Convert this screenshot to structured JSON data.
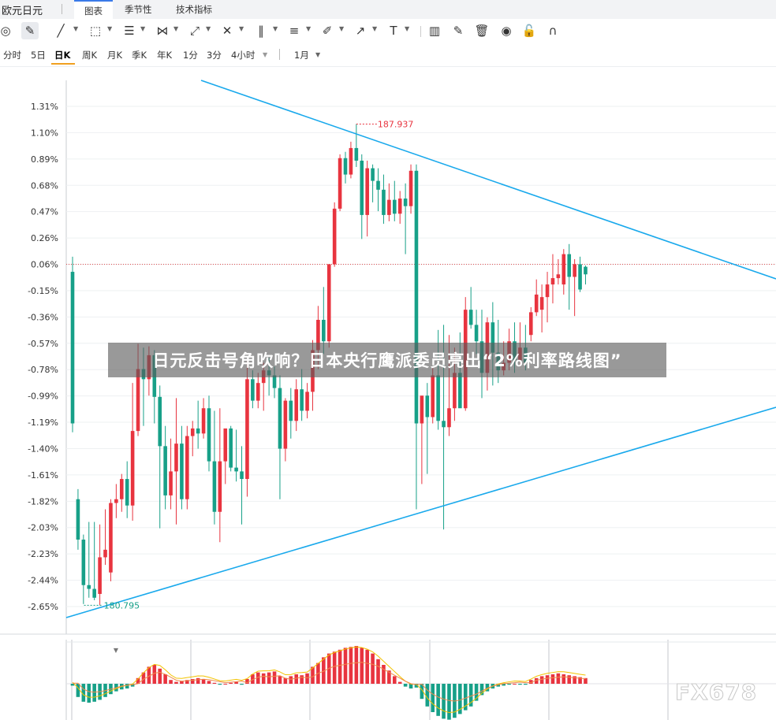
{
  "header": {
    "instrument": "欧元日元",
    "tabs": [
      {
        "label": "图表",
        "active": true
      },
      {
        "label": "季节性",
        "active": false
      },
      {
        "label": "技术指标",
        "active": false
      }
    ]
  },
  "toolbar": {
    "tools": [
      "crosshair-icon",
      "pencil-icon",
      "line-icon",
      "rect-icon",
      "hline-icon",
      "pattern-icon",
      "fib-icon",
      "measure-icon",
      "vlines-icon",
      "parallel-icon",
      "brush-icon",
      "arrow-icon",
      "text-icon",
      "indicator-icon",
      "edit-icon",
      "trash-icon",
      "eye-icon",
      "lock-icon",
      "magnet-icon"
    ]
  },
  "periods": {
    "items": [
      "分时",
      "5日",
      "日K",
      "周K",
      "月K",
      "季K",
      "年K",
      "1分",
      "3分",
      "4小时"
    ],
    "active": "日K",
    "range_label": "1月"
  },
  "banner": {
    "text": "日元反击号角吹响？日本央行鹰派委员亮出“2%利率路线图”"
  },
  "watermark": "FX678",
  "chart_data": {
    "type": "candlestick",
    "y_tick_labels": [
      "1.31%",
      "1.10%",
      "0.89%",
      "0.68%",
      "0.47%",
      "0.26%",
      "0.06%",
      "-0.15%",
      "-0.36%",
      "-0.57%",
      "-0.78%",
      "-0.99%",
      "-1.19%",
      "-1.40%",
      "-1.61%",
      "-1.82%",
      "-2.03%",
      "-2.23%",
      "-2.44%",
      "-2.65%"
    ],
    "ylim_pct": [
      -2.65,
      1.31
    ],
    "reference_pct": 0.06,
    "annotations": {
      "high_label": "187.937",
      "low_label": "180.795"
    },
    "colors": {
      "up": "#e8343f",
      "down": "#17a088",
      "trendline": "#19a9ec",
      "reference": "#e05050"
    },
    "candles": [
      {
        "o": 0.0,
        "h": 0.12,
        "l": -1.27,
        "c": -1.2
      },
      {
        "o": -1.8,
        "h": -1.72,
        "l": -2.2,
        "c": -2.12
      },
      {
        "o": -2.12,
        "h": -2.08,
        "l": -2.63,
        "c": -2.48
      },
      {
        "o": -2.48,
        "h": -1.98,
        "l": -2.58,
        "c": -2.51
      },
      {
        "o": -2.51,
        "h": -1.98,
        "l": -2.6,
        "c": -2.58
      },
      {
        "o": -2.55,
        "h": -2.0,
        "l": -2.64,
        "c": -2.26
      },
      {
        "o": -2.26,
        "h": -1.88,
        "l": -2.32,
        "c": -2.2
      },
      {
        "o": -2.38,
        "h": -1.8,
        "l": -2.45,
        "c": -1.83
      },
      {
        "o": -1.83,
        "h": -1.68,
        "l": -1.95,
        "c": -1.8
      },
      {
        "o": -1.8,
        "h": -1.6,
        "l": -1.9,
        "c": -1.64
      },
      {
        "o": -1.64,
        "h": -1.5,
        "l": -1.95,
        "c": -1.85
      },
      {
        "o": -1.85,
        "h": -0.88,
        "l": -1.97,
        "c": -1.26
      },
      {
        "o": -1.26,
        "h": -0.57,
        "l": -1.3,
        "c": -0.77
      },
      {
        "o": -0.77,
        "h": -0.6,
        "l": -1.22,
        "c": -0.85
      },
      {
        "o": -0.85,
        "h": -0.59,
        "l": -0.98,
        "c": -0.66
      },
      {
        "o": -0.66,
        "h": -0.62,
        "l": -1.2,
        "c": -0.99
      },
      {
        "o": -0.99,
        "h": -0.9,
        "l": -2.03,
        "c": -1.38
      },
      {
        "o": -1.38,
        "h": -1.22,
        "l": -1.88,
        "c": -1.77
      },
      {
        "o": -1.77,
        "h": -1.32,
        "l": -1.88,
        "c": -1.58
      },
      {
        "o": -1.58,
        "h": -1.0,
        "l": -2.0,
        "c": -1.36
      },
      {
        "o": -1.36,
        "h": -1.22,
        "l": -1.88,
        "c": -1.8
      },
      {
        "o": -1.8,
        "h": -1.22,
        "l": -1.88,
        "c": -1.3
      },
      {
        "o": -1.3,
        "h": -1.18,
        "l": -1.46,
        "c": -1.24
      },
      {
        "o": -1.24,
        "h": -1.02,
        "l": -1.4,
        "c": -1.28
      },
      {
        "o": -1.28,
        "h": -1.0,
        "l": -1.32,
        "c": -1.08
      },
      {
        "o": -1.08,
        "h": -0.98,
        "l": -1.58,
        "c": -1.5
      },
      {
        "o": -1.5,
        "h": -1.1,
        "l": -2.0,
        "c": -1.9
      },
      {
        "o": -1.9,
        "h": -1.08,
        "l": -2.14,
        "c": -1.5
      },
      {
        "o": -1.5,
        "h": -1.28,
        "l": -1.68,
        "c": -1.24
      },
      {
        "o": -1.24,
        "h": -1.22,
        "l": -1.58,
        "c": -1.55
      },
      {
        "o": -1.55,
        "h": -1.25,
        "l": -1.66,
        "c": -1.58
      },
      {
        "o": -1.58,
        "h": -1.38,
        "l": -2.0,
        "c": -1.64
      },
      {
        "o": -1.64,
        "h": -0.7,
        "l": -1.78,
        "c": -0.85
      },
      {
        "o": -0.85,
        "h": -0.78,
        "l": -1.08,
        "c": -1.02
      },
      {
        "o": -1.02,
        "h": -0.8,
        "l": -1.08,
        "c": -0.88
      },
      {
        "o": -0.88,
        "h": -0.72,
        "l": -1.1,
        "c": -0.78
      },
      {
        "o": -0.78,
        "h": -0.68,
        "l": -0.98,
        "c": -0.82
      },
      {
        "o": -0.82,
        "h": -0.75,
        "l": -1.0,
        "c": -0.92
      },
      {
        "o": -0.92,
        "h": -0.82,
        "l": -1.8,
        "c": -1.4
      },
      {
        "o": -1.4,
        "h": -1.0,
        "l": -1.5,
        "c": -1.02
      },
      {
        "o": -1.02,
        "h": -0.92,
        "l": -1.32,
        "c": -1.18
      },
      {
        "o": -1.18,
        "h": -0.85,
        "l": -1.26,
        "c": -0.93
      },
      {
        "o": -0.93,
        "h": -0.77,
        "l": -1.18,
        "c": -1.1
      },
      {
        "o": -1.1,
        "h": -0.88,
        "l": -1.16,
        "c": -0.95
      },
      {
        "o": -0.95,
        "h": -0.54,
        "l": -1.1,
        "c": -0.62
      },
      {
        "o": -0.62,
        "h": -0.27,
        "l": -0.77,
        "c": -0.38
      },
      {
        "o": -0.38,
        "h": -0.12,
        "l": -0.65,
        "c": -0.55
      },
      {
        "o": -0.55,
        "h": 0.04,
        "l": -0.6,
        "c": 0.06
      },
      {
        "o": 0.06,
        "h": 0.55,
        "l": 0.04,
        "c": 0.5
      },
      {
        "o": 0.5,
        "h": 0.93,
        "l": 0.48,
        "c": 0.9
      },
      {
        "o": 0.9,
        "h": 0.95,
        "l": 0.7,
        "c": 0.77
      },
      {
        "o": 0.77,
        "h": 1.03,
        "l": 0.74,
        "c": 0.98
      },
      {
        "o": 0.98,
        "h": 1.17,
        "l": 0.83,
        "c": 0.88
      },
      {
        "o": 0.88,
        "h": 0.93,
        "l": 0.26,
        "c": 0.45
      },
      {
        "o": 0.45,
        "h": 0.88,
        "l": 0.28,
        "c": 0.82
      },
      {
        "o": 0.82,
        "h": 0.85,
        "l": 0.55,
        "c": 0.72
      },
      {
        "o": 0.72,
        "h": 0.82,
        "l": 0.48,
        "c": 0.65
      },
      {
        "o": 0.65,
        "h": 0.77,
        "l": 0.38,
        "c": 0.45
      },
      {
        "o": 0.45,
        "h": 0.7,
        "l": 0.4,
        "c": 0.57
      },
      {
        "o": 0.57,
        "h": 0.72,
        "l": 0.4,
        "c": 0.46
      },
      {
        "o": 0.46,
        "h": 0.64,
        "l": 0.38,
        "c": 0.58
      },
      {
        "o": 0.58,
        "h": 0.7,
        "l": 0.14,
        "c": 0.52
      },
      {
        "o": 0.52,
        "h": 0.85,
        "l": 0.46,
        "c": 0.8
      },
      {
        "o": 0.8,
        "h": 0.85,
        "l": -1.88,
        "c": -1.2
      },
      {
        "o": -1.2,
        "h": -1.08,
        "l": -1.68,
        "c": -0.98
      },
      {
        "o": -0.98,
        "h": -0.88,
        "l": -1.6,
        "c": -1.15
      },
      {
        "o": -1.15,
        "h": -0.75,
        "l": -1.2,
        "c": -0.82
      },
      {
        "o": -0.82,
        "h": -0.46,
        "l": -1.25,
        "c": -1.18
      },
      {
        "o": -1.18,
        "h": -0.42,
        "l": -2.04,
        "c": -1.23
      },
      {
        "o": -1.23,
        "h": -0.5,
        "l": -1.3,
        "c": -1.08
      },
      {
        "o": -1.08,
        "h": -0.6,
        "l": -1.18,
        "c": -0.8
      },
      {
        "o": -0.8,
        "h": -0.48,
        "l": -0.98,
        "c": -1.08
      },
      {
        "o": -1.08,
        "h": -0.2,
        "l": -1.1,
        "c": -0.3
      },
      {
        "o": -0.3,
        "h": -0.12,
        "l": -0.45,
        "c": -0.42
      },
      {
        "o": -0.42,
        "h": -0.3,
        "l": -0.65,
        "c": -0.55
      },
      {
        "o": -0.55,
        "h": -0.3,
        "l": -1.0,
        "c": -0.8
      },
      {
        "o": -0.8,
        "h": -0.36,
        "l": -0.94,
        "c": -0.4
      },
      {
        "o": -0.4,
        "h": -0.24,
        "l": -0.9,
        "c": -0.64
      },
      {
        "o": -0.64,
        "h": -0.38,
        "l": -0.88,
        "c": -0.78
      },
      {
        "o": -0.78,
        "h": -0.55,
        "l": -0.82,
        "c": -0.72
      },
      {
        "o": -0.72,
        "h": -0.45,
        "l": -0.78,
        "c": -0.55
      },
      {
        "o": -0.55,
        "h": -0.4,
        "l": -0.8,
        "c": -0.7
      },
      {
        "o": -0.7,
        "h": -0.4,
        "l": -0.75,
        "c": -0.6
      },
      {
        "o": -0.6,
        "h": -0.42,
        "l": -0.78,
        "c": -0.72
      },
      {
        "o": -0.5,
        "h": -0.28,
        "l": -0.55,
        "c": -0.32
      },
      {
        "o": -0.32,
        "h": -0.06,
        "l": -0.35,
        "c": -0.18
      },
      {
        "o": -0.3,
        "h": -0.1,
        "l": -0.48,
        "c": -0.2
      },
      {
        "o": -0.2,
        "h": 0.0,
        "l": -0.4,
        "c": -0.1
      },
      {
        "o": -0.1,
        "h": 0.14,
        "l": -0.25,
        "c": -0.05
      },
      {
        "o": -0.05,
        "h": 0.1,
        "l": -0.1,
        "c": -0.02
      },
      {
        "o": -0.1,
        "h": 0.18,
        "l": -0.18,
        "c": 0.14
      },
      {
        "o": 0.14,
        "h": 0.22,
        "l": -0.3,
        "c": -0.04
      },
      {
        "o": -0.04,
        "h": 0.1,
        "l": -0.35,
        "c": 0.06
      },
      {
        "o": 0.06,
        "h": 0.12,
        "l": -0.16,
        "c": -0.14
      },
      {
        "o": 0.04,
        "h": 0.05,
        "l": -0.1,
        "c": -0.02
      }
    ],
    "macd_bars": [
      -0.1,
      -0.7,
      -0.95,
      -1.0,
      -0.95,
      -0.85,
      -0.7,
      -0.55,
      -0.4,
      -0.3,
      -0.25,
      -0.15,
      0.3,
      0.6,
      0.9,
      1.0,
      0.8,
      0.5,
      0.2,
      0.1,
      0.15,
      0.2,
      0.25,
      0.3,
      0.25,
      0.15,
      0.05,
      -0.05,
      0.0,
      0.05,
      0.1,
      -0.05,
      0.25,
      0.5,
      0.6,
      0.55,
      0.6,
      0.65,
      0.4,
      0.3,
      0.4,
      0.5,
      0.45,
      0.55,
      0.9,
      1.1,
      1.4,
      1.6,
      1.7,
      1.8,
      1.9,
      1.95,
      2.0,
      1.9,
      1.8,
      1.6,
      1.3,
      1.0,
      0.7,
      0.4,
      0.1,
      -0.15,
      -0.25,
      -0.2,
      -0.8,
      -1.2,
      -1.5,
      -1.7,
      -1.85,
      -1.9,
      -1.8,
      -1.6,
      -1.4,
      -1.2,
      -0.9,
      -0.6,
      -0.4,
      -0.25,
      -0.15,
      -0.1,
      -0.05,
      0.0,
      -0.05,
      -0.05,
      0.2,
      0.3,
      0.4,
      0.45,
      0.5,
      0.55,
      0.5,
      0.45,
      0.4,
      0.35,
      0.3
    ]
  }
}
